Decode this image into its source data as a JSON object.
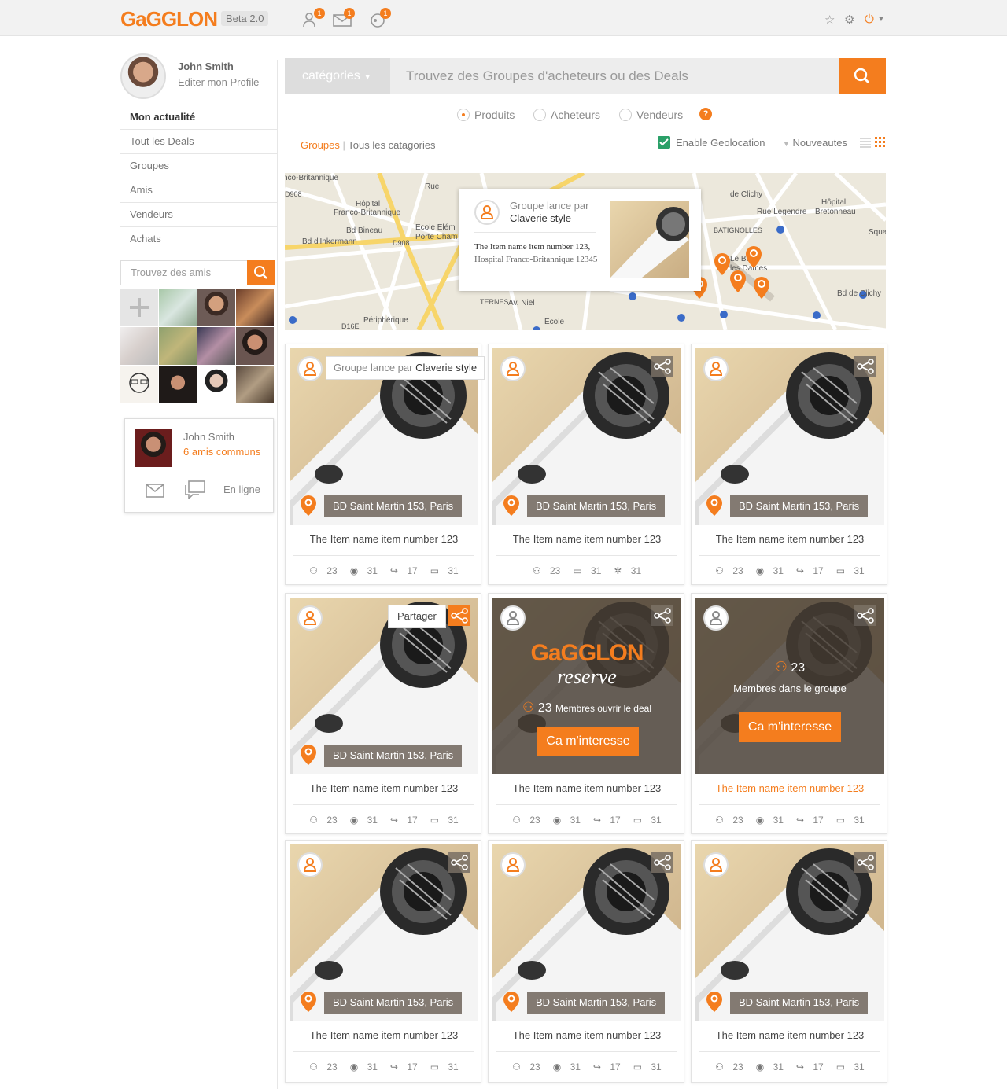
{
  "header": {
    "logo": "GaGGLON",
    "beta": "Beta 2.0",
    "notif_friends": "1",
    "notif_messages": "1",
    "notif_deals": "1"
  },
  "profile": {
    "name": "John Smith",
    "edit": "Editer mon Profile"
  },
  "nav": [
    {
      "label": "Mon actualité"
    },
    {
      "label": "Tout les Deals"
    },
    {
      "label": "Groupes"
    },
    {
      "label": "Amis"
    },
    {
      "label": "Vendeurs"
    },
    {
      "label": "Achats"
    }
  ],
  "friend_search": {
    "placeholder": "Trouvez des amis"
  },
  "friend_popup": {
    "name": "John Smith",
    "common": "6 amis communs",
    "status": "En ligne"
  },
  "search": {
    "category": "catégories",
    "placeholder": "Trouvez des Groupes d'acheteurs ou des Deals"
  },
  "filters": {
    "radio_produits": "Produits",
    "radio_acheteurs": "Acheteurs",
    "radio_vendeurs": "Vendeurs",
    "breadcrumb_groups": "Groupes",
    "breadcrumb_all": "Tous les catagories",
    "geo": "Enable Geolocation",
    "sort": "Nouveautes"
  },
  "map": {
    "popup_title": "Groupe lance par",
    "popup_user": "Claverie style",
    "popup_item": "The Item name item number 123,",
    "popup_loc": "Hospital Franco-Britannique 12345",
    "labels": {
      "hospital": "Hôpital",
      "franco": "Franco-Britannique",
      "ecole": "Ecole Elém",
      "porte": "Porte Cham",
      "bdbineau": "Bd Bineau",
      "d908": "D908",
      "d908b": "D908",
      "batignolles": "BATIGNOLLES",
      "lebois": "Le Bois",
      "dames": "les Dames",
      "hopbret": "Hôpital",
      "bretonneau": "Bretonneau",
      "bdclichy": "Bd de Clichy",
      "ternes": "TERNES",
      "ecole2": "Ecole",
      "d16e": "D16E",
      "avniel": "Av. Niel",
      "lelegendre": "Rue Legendre",
      "square": "Squa Buis",
      "rue": "Rue",
      "bdinkermann": "Bd d'Inkermann",
      "peripherique": "Périphérique",
      "cl": "de Clichy",
      "fn": "nco-Britannique"
    }
  },
  "cards": [
    {
      "loc": "BD Saint Martin 153, Paris",
      "title": "The Item name item number 123",
      "stats": [
        "23",
        "31",
        "17",
        "31"
      ],
      "tooltip_label": "Groupe lance par",
      "tooltip_user": "Claverie style"
    },
    {
      "loc": "BD Saint Martin 153, Paris",
      "title": "The Item name item number 123",
      "stats": [
        "23",
        "31",
        "31"
      ]
    },
    {
      "loc": "BD Saint Martin 153, Paris",
      "title": "The Item name item number 123",
      "stats": [
        "23",
        "31",
        "17",
        "31"
      ]
    },
    {
      "loc": "BD Saint Martin 153, Paris",
      "title": "The Item name item number 123",
      "stats": [
        "23",
        "31",
        "17",
        "31"
      ],
      "share_label": "Partager"
    },
    {
      "title": "The Item name item number 123",
      "stats": [
        "23",
        "31",
        "17",
        "31"
      ],
      "brand": "GaGGLON",
      "reserve": "reserve",
      "count": "23",
      "members": "Membres ouvrir le deal",
      "cta": "Ca m'interesse"
    },
    {
      "title": "The Item name item number 123",
      "stats": [
        "23",
        "31",
        "17",
        "31"
      ],
      "count": "23",
      "members": "Membres dans le groupe",
      "cta": "Ca m'interesse"
    },
    {
      "loc": "BD Saint Martin 153, Paris",
      "title": "The Item name item number 123",
      "stats": [
        "23",
        "31",
        "17",
        "31"
      ]
    },
    {
      "loc": "BD Saint Martin 153, Paris",
      "title": "The Item name item number 123",
      "stats": [
        "23",
        "31",
        "17",
        "31"
      ]
    },
    {
      "loc": "BD Saint Martin 153, Paris",
      "title": "The Item name item number 123",
      "stats": [
        "23",
        "31",
        "17",
        "31"
      ]
    }
  ],
  "colors": {
    "accent": "#f47d1e"
  }
}
